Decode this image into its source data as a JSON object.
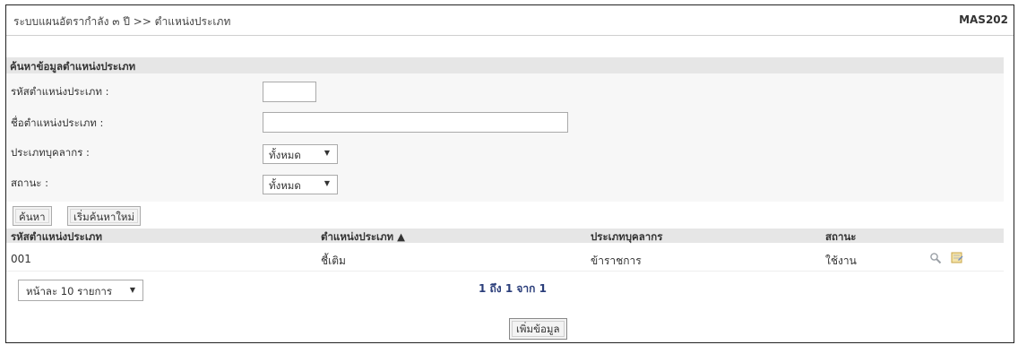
{
  "header": {
    "title": "ระบบแผนอัตรากำลัง ๓ ปี >> ตำแหน่งประเภท",
    "code": "MAS202"
  },
  "search": {
    "section_title": "ค้นหาข้อมูลตำแหน่งประเภท",
    "code_label": "รหัสตำแหน่งประเภท :",
    "code_value": "",
    "name_label": "ชื่อตำแหน่งประเภท :",
    "name_value": "",
    "personnel_type_label": "ประเภทบุคลากร :",
    "personnel_type_selected": "ทั้งหมด",
    "status_label": "สถานะ :",
    "status_selected": "ทั้งหมด",
    "search_button": "ค้นหา",
    "reset_button": "เริ่มค้นหาใหม่"
  },
  "table": {
    "columns": [
      "รหัสตำแหน่งประเภท",
      "ตำแหน่งประเภท ▲",
      "ประเภทบุคลากร",
      "สถานะ"
    ],
    "rows": [
      {
        "code": "001",
        "name": "ชี้เติม",
        "personnel_type": "ข้าราชการ",
        "status": "ใช้งาน"
      }
    ],
    "row_icons": [
      "view-icon",
      "edit-icon"
    ]
  },
  "pagination": {
    "page_size_selected": "หน้าละ 10 รายการ",
    "info": "1 ถึง 1 จาก 1"
  },
  "actions": {
    "add_button": "เพิ่มข้อมูล"
  }
}
